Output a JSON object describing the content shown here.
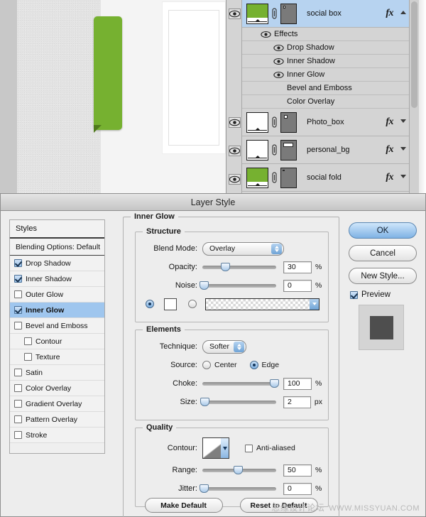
{
  "canvas": {
    "green_color": "#76b130",
    "fold_color": "#4f7a1c"
  },
  "layers_panel": {
    "layers": [
      {
        "name": "social box",
        "thumb_color": "#76b130",
        "selected": true,
        "has_fx": true,
        "fx_label": "fx",
        "expanded": true,
        "eye": "eye-icon"
      },
      {
        "name": "Photo_box",
        "thumb_color": "#ffffff",
        "selected": false,
        "has_fx": true,
        "fx_label": "fx",
        "expanded": false,
        "eye": "eye-icon"
      },
      {
        "name": "personal_bg",
        "thumb_color": "#ffffff",
        "selected": false,
        "has_fx": true,
        "fx_label": "fx",
        "expanded": false,
        "eye": "eye-icon"
      },
      {
        "name": "social fold",
        "thumb_color": "#76b130",
        "selected": false,
        "has_fx": true,
        "fx_label": "fx",
        "expanded": false,
        "eye": "eye-icon"
      }
    ],
    "effects_group_label": "Effects",
    "effects": [
      {
        "label": "Drop Shadow",
        "visible": true
      },
      {
        "label": "Inner Shadow",
        "visible": true
      },
      {
        "label": "Inner Glow",
        "visible": true
      },
      {
        "label": "Bevel and Emboss",
        "visible": false
      },
      {
        "label": "Color Overlay",
        "visible": false
      }
    ]
  },
  "dialog": {
    "title": "Layer Style",
    "styles_panel": {
      "header": "Styles",
      "blending_options": "Blending Options: Default",
      "items": [
        {
          "label": "Drop Shadow",
          "checked": true,
          "indent": false,
          "active": false
        },
        {
          "label": "Inner Shadow",
          "checked": true,
          "indent": false,
          "active": false
        },
        {
          "label": "Outer Glow",
          "checked": false,
          "indent": false,
          "active": false
        },
        {
          "label": "Inner Glow",
          "checked": true,
          "indent": false,
          "active": true
        },
        {
          "label": "Bevel and Emboss",
          "checked": false,
          "indent": false,
          "active": false
        },
        {
          "label": "Contour",
          "checked": false,
          "indent": true,
          "active": false
        },
        {
          "label": "Texture",
          "checked": false,
          "indent": true,
          "active": false
        },
        {
          "label": "Satin",
          "checked": false,
          "indent": false,
          "active": false
        },
        {
          "label": "Color Overlay",
          "checked": false,
          "indent": false,
          "active": false
        },
        {
          "label": "Gradient Overlay",
          "checked": false,
          "indent": false,
          "active": false
        },
        {
          "label": "Pattern Overlay",
          "checked": false,
          "indent": false,
          "active": false
        },
        {
          "label": "Stroke",
          "checked": false,
          "indent": false,
          "active": false
        }
      ]
    },
    "section_title": "Inner Glow",
    "structure": {
      "legend": "Structure",
      "blend_mode_label": "Blend Mode:",
      "blend_mode_value": "Overlay",
      "opacity_label": "Opacity:",
      "opacity_value": "30",
      "opacity_unit": "%",
      "noise_label": "Noise:",
      "noise_value": "0",
      "noise_unit": "%",
      "fill_type": "gradient"
    },
    "elements": {
      "legend": "Elements",
      "technique_label": "Technique:",
      "technique_value": "Softer",
      "source_label": "Source:",
      "source_center": "Center",
      "source_edge": "Edge",
      "source_selected": "Edge",
      "choke_label": "Choke:",
      "choke_value": "100",
      "choke_unit": "%",
      "size_label": "Size:",
      "size_value": "2",
      "size_unit": "px"
    },
    "quality": {
      "legend": "Quality",
      "contour_label": "Contour:",
      "anti_aliased_label": "Anti-aliased",
      "anti_aliased_checked": false,
      "range_label": "Range:",
      "range_value": "50",
      "range_unit": "%",
      "jitter_label": "Jitter:",
      "jitter_value": "0",
      "jitter_unit": "%"
    },
    "buttons": {
      "ok": "OK",
      "cancel": "Cancel",
      "new_style": "New Style...",
      "preview": "Preview",
      "preview_checked": true,
      "make_default": "Make Default",
      "reset_to_default": "Reset to Default"
    }
  },
  "watermark": {
    "cn": "思缘设计论坛",
    "url": "WWW.MISSYUAN.COM"
  }
}
